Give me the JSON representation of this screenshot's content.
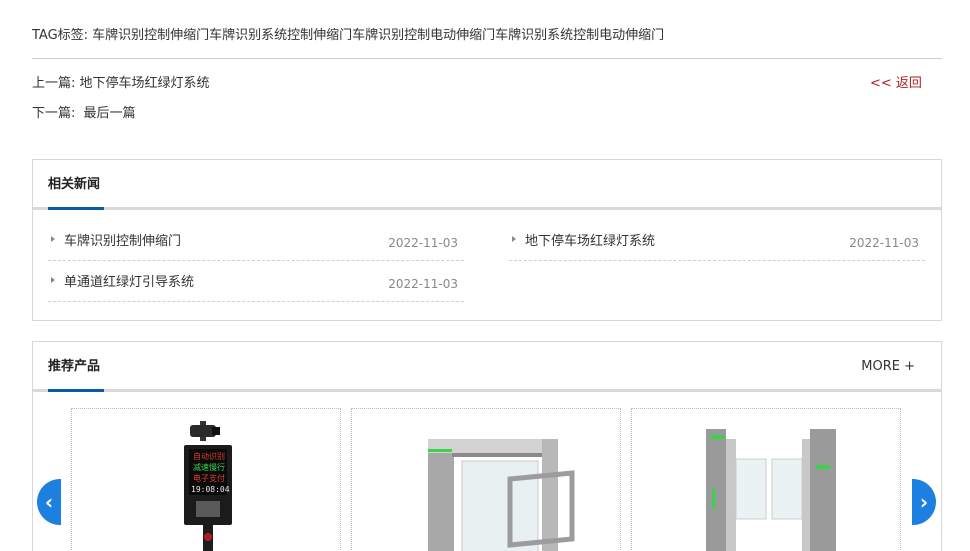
{
  "article": {
    "tags_line": "TAG标签: 车牌识别控制伸缩门车牌识别系统控制伸缩门车牌识别控制电动伸缩门车牌识别系统控制电动伸缩门",
    "prev_label": "上一篇:",
    "prev_title": "地下停车场红绿灯系统",
    "next_label": "下一篇:",
    "next_title": "最后一篇",
    "back_label": "<< 返回"
  },
  "related": {
    "title": "相关新闻",
    "items": [
      {
        "title": "车牌识别控制伸缩门",
        "date": "2022-11-03"
      },
      {
        "title": "地下停车场红绿灯系统",
        "date": "2022-11-03"
      },
      {
        "title": "单通道红绿灯引导系统",
        "date": "2022-11-03"
      }
    ]
  },
  "products": {
    "title": "推荐产品",
    "more_label": "MORE +",
    "prev_glyph": "‹",
    "next_glyph": "›",
    "display_lines": [
      "自动识别",
      "减速慢行",
      "电子支付",
      "19:08:04"
    ],
    "colors": {
      "accent": "#0b5aa8",
      "nav": "#1d7fe0",
      "back_link": "#b01e23"
    }
  }
}
